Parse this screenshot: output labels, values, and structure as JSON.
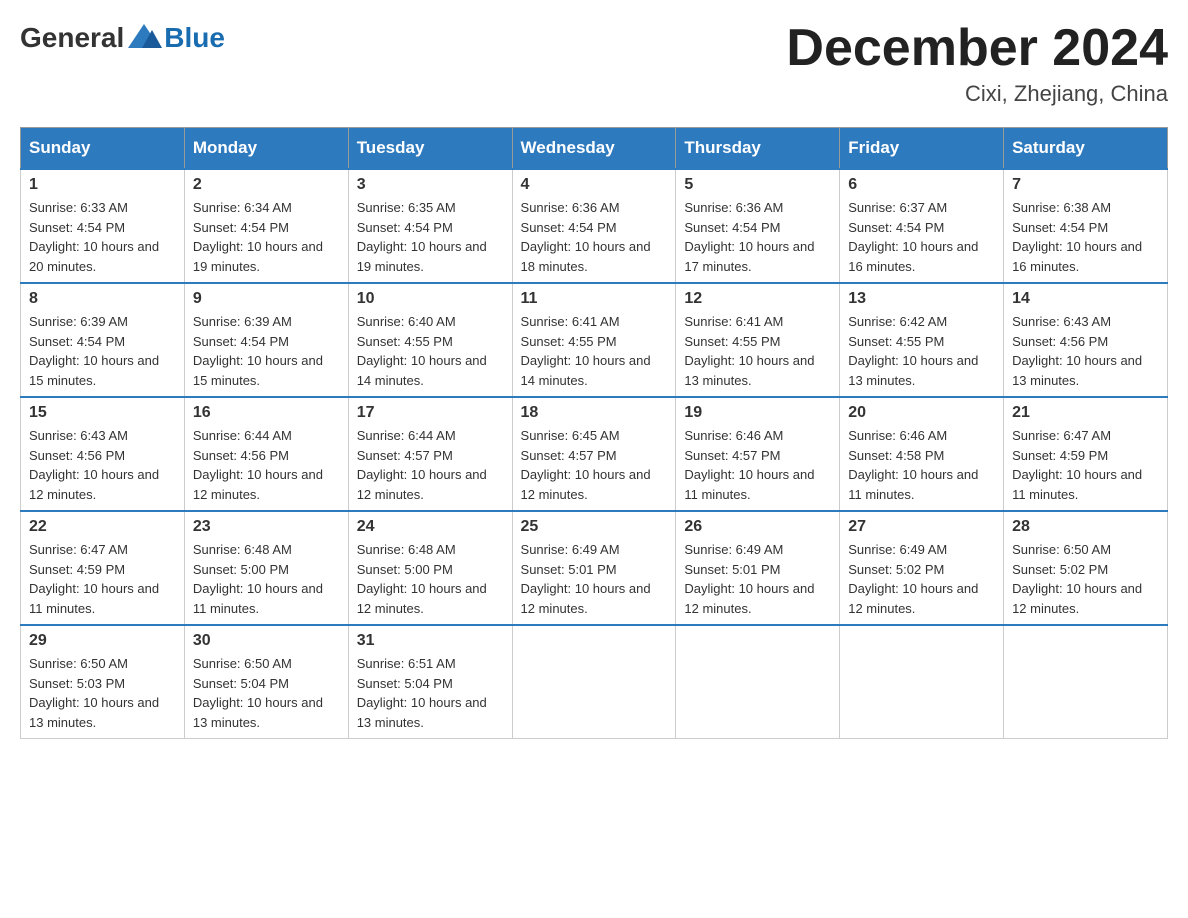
{
  "logo": {
    "general": "General",
    "blue": "Blue"
  },
  "title": "December 2024",
  "location": "Cixi, Zhejiang, China",
  "headers": [
    "Sunday",
    "Monday",
    "Tuesday",
    "Wednesday",
    "Thursday",
    "Friday",
    "Saturday"
  ],
  "weeks": [
    [
      {
        "day": "1",
        "sunrise": "6:33 AM",
        "sunset": "4:54 PM",
        "daylight": "10 hours and 20 minutes."
      },
      {
        "day": "2",
        "sunrise": "6:34 AM",
        "sunset": "4:54 PM",
        "daylight": "10 hours and 19 minutes."
      },
      {
        "day": "3",
        "sunrise": "6:35 AM",
        "sunset": "4:54 PM",
        "daylight": "10 hours and 19 minutes."
      },
      {
        "day": "4",
        "sunrise": "6:36 AM",
        "sunset": "4:54 PM",
        "daylight": "10 hours and 18 minutes."
      },
      {
        "day": "5",
        "sunrise": "6:36 AM",
        "sunset": "4:54 PM",
        "daylight": "10 hours and 17 minutes."
      },
      {
        "day": "6",
        "sunrise": "6:37 AM",
        "sunset": "4:54 PM",
        "daylight": "10 hours and 16 minutes."
      },
      {
        "day": "7",
        "sunrise": "6:38 AM",
        "sunset": "4:54 PM",
        "daylight": "10 hours and 16 minutes."
      }
    ],
    [
      {
        "day": "8",
        "sunrise": "6:39 AM",
        "sunset": "4:54 PM",
        "daylight": "10 hours and 15 minutes."
      },
      {
        "day": "9",
        "sunrise": "6:39 AM",
        "sunset": "4:54 PM",
        "daylight": "10 hours and 15 minutes."
      },
      {
        "day": "10",
        "sunrise": "6:40 AM",
        "sunset": "4:55 PM",
        "daylight": "10 hours and 14 minutes."
      },
      {
        "day": "11",
        "sunrise": "6:41 AM",
        "sunset": "4:55 PM",
        "daylight": "10 hours and 14 minutes."
      },
      {
        "day": "12",
        "sunrise": "6:41 AM",
        "sunset": "4:55 PM",
        "daylight": "10 hours and 13 minutes."
      },
      {
        "day": "13",
        "sunrise": "6:42 AM",
        "sunset": "4:55 PM",
        "daylight": "10 hours and 13 minutes."
      },
      {
        "day": "14",
        "sunrise": "6:43 AM",
        "sunset": "4:56 PM",
        "daylight": "10 hours and 13 minutes."
      }
    ],
    [
      {
        "day": "15",
        "sunrise": "6:43 AM",
        "sunset": "4:56 PM",
        "daylight": "10 hours and 12 minutes."
      },
      {
        "day": "16",
        "sunrise": "6:44 AM",
        "sunset": "4:56 PM",
        "daylight": "10 hours and 12 minutes."
      },
      {
        "day": "17",
        "sunrise": "6:44 AM",
        "sunset": "4:57 PM",
        "daylight": "10 hours and 12 minutes."
      },
      {
        "day": "18",
        "sunrise": "6:45 AM",
        "sunset": "4:57 PM",
        "daylight": "10 hours and 12 minutes."
      },
      {
        "day": "19",
        "sunrise": "6:46 AM",
        "sunset": "4:57 PM",
        "daylight": "10 hours and 11 minutes."
      },
      {
        "day": "20",
        "sunrise": "6:46 AM",
        "sunset": "4:58 PM",
        "daylight": "10 hours and 11 minutes."
      },
      {
        "day": "21",
        "sunrise": "6:47 AM",
        "sunset": "4:59 PM",
        "daylight": "10 hours and 11 minutes."
      }
    ],
    [
      {
        "day": "22",
        "sunrise": "6:47 AM",
        "sunset": "4:59 PM",
        "daylight": "10 hours and 11 minutes."
      },
      {
        "day": "23",
        "sunrise": "6:48 AM",
        "sunset": "5:00 PM",
        "daylight": "10 hours and 11 minutes."
      },
      {
        "day": "24",
        "sunrise": "6:48 AM",
        "sunset": "5:00 PM",
        "daylight": "10 hours and 12 minutes."
      },
      {
        "day": "25",
        "sunrise": "6:49 AM",
        "sunset": "5:01 PM",
        "daylight": "10 hours and 12 minutes."
      },
      {
        "day": "26",
        "sunrise": "6:49 AM",
        "sunset": "5:01 PM",
        "daylight": "10 hours and 12 minutes."
      },
      {
        "day": "27",
        "sunrise": "6:49 AM",
        "sunset": "5:02 PM",
        "daylight": "10 hours and 12 minutes."
      },
      {
        "day": "28",
        "sunrise": "6:50 AM",
        "sunset": "5:02 PM",
        "daylight": "10 hours and 12 minutes."
      }
    ],
    [
      {
        "day": "29",
        "sunrise": "6:50 AM",
        "sunset": "5:03 PM",
        "daylight": "10 hours and 13 minutes."
      },
      {
        "day": "30",
        "sunrise": "6:50 AM",
        "sunset": "5:04 PM",
        "daylight": "10 hours and 13 minutes."
      },
      {
        "day": "31",
        "sunrise": "6:51 AM",
        "sunset": "5:04 PM",
        "daylight": "10 hours and 13 minutes."
      },
      null,
      null,
      null,
      null
    ]
  ]
}
